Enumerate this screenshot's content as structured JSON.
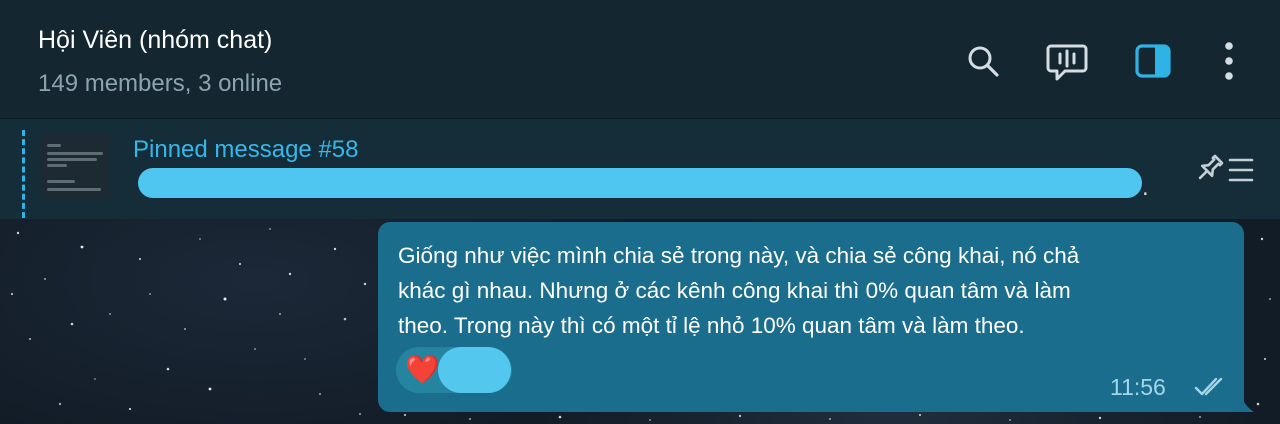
{
  "header": {
    "title": "Hội Viên (nhóm chat)",
    "subtitle": "149 members, 3 online",
    "icons": [
      "search-icon",
      "voice-chat-icon",
      "sidebar-toggle-icon",
      "more-vertical-icon"
    ]
  },
  "pinned": {
    "title": "Pinned message #58",
    "preview_visible_end": ".",
    "icon": "pinned-list-icon"
  },
  "message": {
    "text": "Giống như việc mình chia sẻ trong này, và chia sẻ công khai, nó chả\nkhác gì nhau. Nhưng ở các kênh công khai thì 0% quan tâm và làm\ntheo. Trong này thì có một tỉ lệ nhỏ 10% quan tâm và làm theo.",
    "reaction_emoji": "❤️",
    "time": "11:56",
    "status": "read"
  },
  "colors": {
    "header_bg": "#14262f",
    "pinned_bg": "#152d39",
    "accent": "#35b7ea",
    "bubble_bg": "#1a6d8c",
    "icon_active": "#2fb3e6"
  }
}
